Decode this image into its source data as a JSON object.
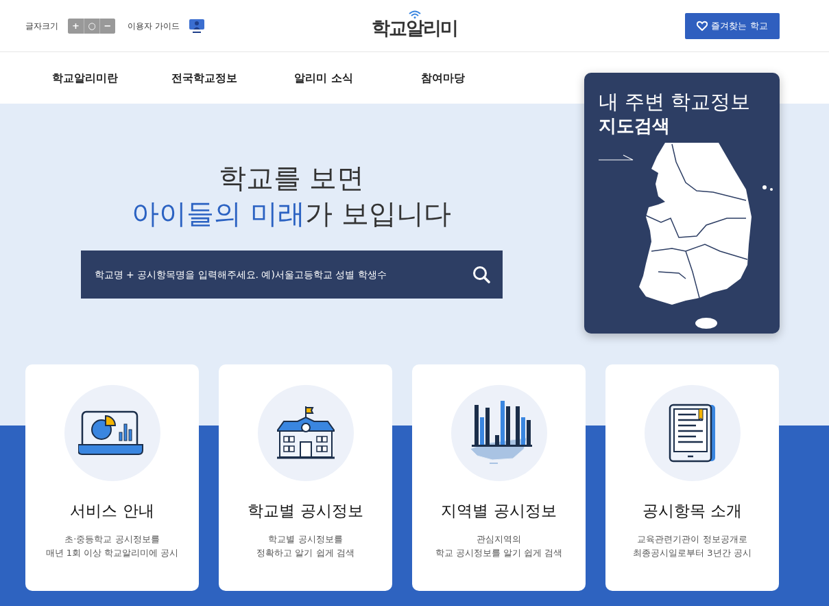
{
  "header": {
    "font_size_label": "글자크기",
    "font_size_buttons": [
      {
        "symbol": "+"
      },
      {
        "symbol": "○"
      },
      {
        "symbol": "−"
      }
    ],
    "user_guide": "이용자 가이드",
    "logo": "학교알리미",
    "favorites_button": "즐겨찾는 학교"
  },
  "nav": {
    "items": [
      {
        "label": "학교알리미란"
      },
      {
        "label": "전국학교정보"
      },
      {
        "label": "알리미 소식"
      },
      {
        "label": "참여마당"
      }
    ]
  },
  "hero": {
    "line1": "학교를 보면",
    "line2": "**아이들의 미래**가 보입니다",
    "search": {
      "placeholder": "학교명 + 공시항목명을 입력해주세요. 예)서울고등학교 성별 학생수"
    }
  },
  "map_card": {
    "title_line1": "내 주변 학교정보",
    "title_line2": "지도검색"
  },
  "cards": [
    {
      "kind": "laptop",
      "title": "서비스 안내",
      "desc_line1": "초·중등학교 공시정보를",
      "desc_line2": "매년 1회 이상 학교알리미에 공시"
    },
    {
      "kind": "school",
      "title": "학교별 공시정보",
      "desc_line1": "학교별 공시정보를",
      "desc_line2": "정확하고 알기 쉽게 검색"
    },
    {
      "kind": "region",
      "title": "지역별 공시정보",
      "desc_line1": "관심지역의",
      "desc_line2": "학교 공시정보를 알기 쉽게 검색"
    },
    {
      "kind": "tablet",
      "title": "공시항목 소개",
      "desc_line1": "교육관련기관이 정보공개로",
      "desc_line2": "최종공시일로부터 3년간 공시"
    }
  ]
}
